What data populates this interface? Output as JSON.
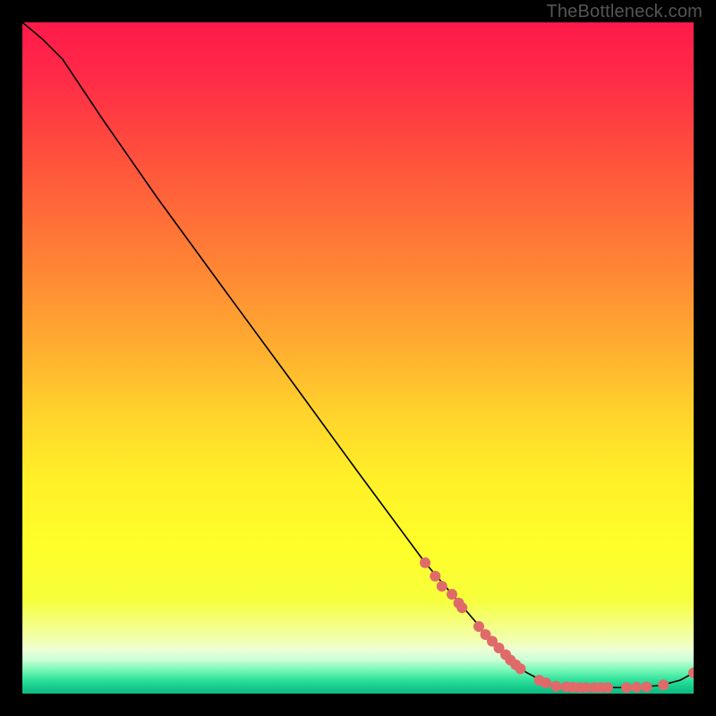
{
  "watermark": "TheBottleneck.com",
  "chart_data": {
    "type": "line",
    "title": "",
    "xlabel": "",
    "ylabel": "",
    "xlim": [
      0,
      100
    ],
    "ylim": [
      0,
      100
    ],
    "grid": false,
    "series": [
      {
        "name": "curve",
        "points": [
          {
            "x": 0,
            "y": 100
          },
          {
            "x": 3,
            "y": 97.5
          },
          {
            "x": 6,
            "y": 94.5
          },
          {
            "x": 9,
            "y": 90.0
          },
          {
            "x": 12,
            "y": 85.5
          },
          {
            "x": 20,
            "y": 74.0
          },
          {
            "x": 30,
            "y": 60.3
          },
          {
            "x": 40,
            "y": 46.7
          },
          {
            "x": 50,
            "y": 33.0
          },
          {
            "x": 60,
            "y": 19.5
          },
          {
            "x": 70,
            "y": 7.8
          },
          {
            "x": 75,
            "y": 3.2
          },
          {
            "x": 78,
            "y": 1.6
          },
          {
            "x": 80,
            "y": 1.0
          },
          {
            "x": 85,
            "y": 0.9
          },
          {
            "x": 90,
            "y": 0.9
          },
          {
            "x": 95,
            "y": 1.2
          },
          {
            "x": 98,
            "y": 2.0
          },
          {
            "x": 100,
            "y": 3.1
          }
        ]
      }
    ],
    "markers": [
      {
        "x": 60,
        "y": 19.5
      },
      {
        "x": 61.5,
        "y": 17.5
      },
      {
        "x": 62.5,
        "y": 16.0
      },
      {
        "x": 64,
        "y": 14.8
      },
      {
        "x": 65,
        "y": 13.5
      },
      {
        "x": 65.5,
        "y": 12.8
      },
      {
        "x": 68,
        "y": 10.0
      },
      {
        "x": 69,
        "y": 8.8
      },
      {
        "x": 70,
        "y": 7.8
      },
      {
        "x": 71,
        "y": 6.8
      },
      {
        "x": 72,
        "y": 5.8
      },
      {
        "x": 72.7,
        "y": 5.0
      },
      {
        "x": 73.5,
        "y": 4.3
      },
      {
        "x": 74.2,
        "y": 3.7
      },
      {
        "x": 77,
        "y": 2.0
      },
      {
        "x": 78,
        "y": 1.6
      },
      {
        "x": 79.5,
        "y": 1.1
      },
      {
        "x": 81,
        "y": 1.0
      },
      {
        "x": 82,
        "y": 0.95
      },
      {
        "x": 83,
        "y": 0.9
      },
      {
        "x": 84,
        "y": 0.9
      },
      {
        "x": 85.2,
        "y": 0.9
      },
      {
        "x": 86.2,
        "y": 0.9
      },
      {
        "x": 87.2,
        "y": 0.9
      },
      {
        "x": 90,
        "y": 0.9
      },
      {
        "x": 91.5,
        "y": 0.95
      },
      {
        "x": 93,
        "y": 1.0
      },
      {
        "x": 95.5,
        "y": 1.3
      },
      {
        "x": 100,
        "y": 3.1
      }
    ],
    "gradient_stops": [
      {
        "pos": 0.0,
        "color": "#ff1a4a"
      },
      {
        "pos": 0.08,
        "color": "#ff2a48"
      },
      {
        "pos": 0.18,
        "color": "#ff4a3e"
      },
      {
        "pos": 0.28,
        "color": "#ff6a38"
      },
      {
        "pos": 0.38,
        "color": "#ff8a34"
      },
      {
        "pos": 0.48,
        "color": "#ffac30"
      },
      {
        "pos": 0.58,
        "color": "#ffd22c"
      },
      {
        "pos": 0.68,
        "color": "#fff028"
      },
      {
        "pos": 0.78,
        "color": "#fffe2a"
      },
      {
        "pos": 0.86,
        "color": "#f6ff3a"
      },
      {
        "pos": 0.92,
        "color": "#f2ffb0"
      },
      {
        "pos": 0.935,
        "color": "#ecffd6"
      },
      {
        "pos": 0.95,
        "color": "#caffd6"
      },
      {
        "pos": 0.965,
        "color": "#77f7b6"
      },
      {
        "pos": 0.978,
        "color": "#36e49e"
      },
      {
        "pos": 0.988,
        "color": "#1ad08e"
      },
      {
        "pos": 1.0,
        "color": "#0fb880"
      }
    ],
    "marker_color": "#e06a6a",
    "line_color": "#000000"
  }
}
